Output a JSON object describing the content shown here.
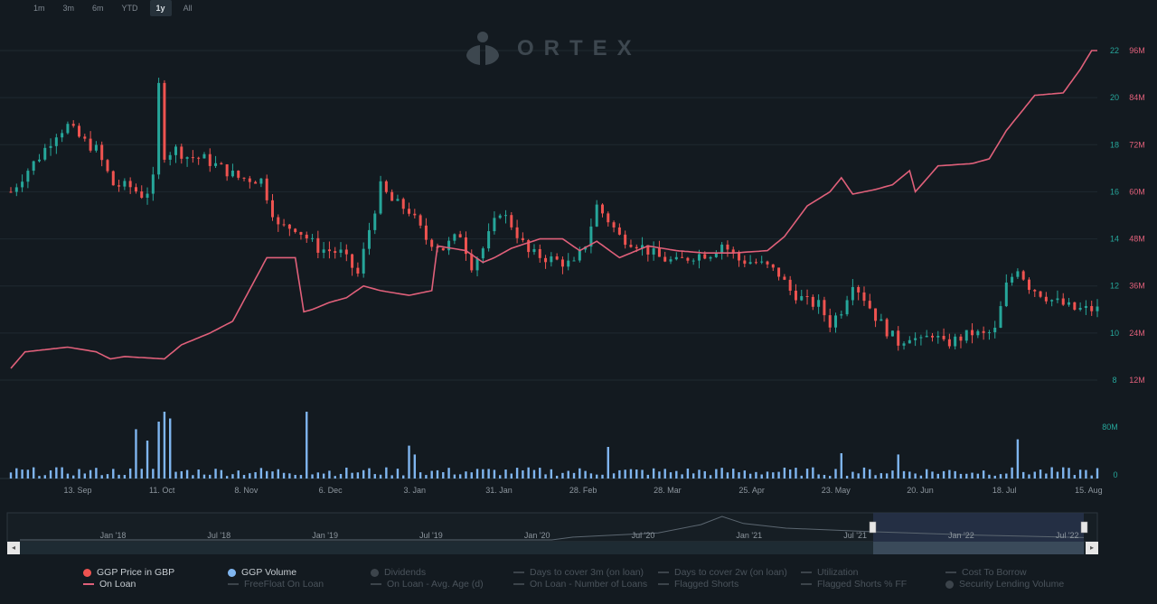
{
  "range_selector": {
    "buttons": [
      "1m",
      "3m",
      "6m",
      "YTD",
      "1y",
      "All"
    ],
    "active": "1y"
  },
  "logo_text": "ORTEX",
  "colors": {
    "up": "#26a69a",
    "down": "#ef5350",
    "on_loan": "#e0607a",
    "volume": "#7fb5ef",
    "left_axis": "#26a69a",
    "right_axis": "#e0607a",
    "background": "#131a20"
  },
  "chart_data": {
    "type": "candlestick",
    "x_tick_labels": [
      "13. Sep",
      "11. Oct",
      "8. Nov",
      "6. Dec",
      "3. Jan",
      "31. Jan",
      "28. Feb",
      "28. Mar",
      "25. Apr",
      "23. May",
      "20. Jun",
      "18. Jul",
      "15. Aug"
    ],
    "price_axis": {
      "ticks": [
        8,
        10,
        12,
        14,
        16,
        18,
        20,
        22
      ],
      "ylim": [
        8,
        22
      ]
    },
    "on_loan_axis": {
      "ticks": [
        "12M",
        "24M",
        "36M",
        "48M",
        "60M",
        "72M",
        "84M",
        "96M"
      ],
      "ylim": [
        12,
        96
      ],
      "unit": "M"
    },
    "volume_axis": {
      "ticks": [
        "0",
        "80M"
      ],
      "ylim": [
        0,
        80
      ]
    },
    "price_series_name": "GGP Price in GBP",
    "volume_series_name": "GGP Volume",
    "on_loan_series_name": "On Loan",
    "price_close_waypoints": [
      [
        0,
        16.0
      ],
      [
        5,
        16.8
      ],
      [
        10,
        17.5
      ],
      [
        16,
        18.5
      ],
      [
        20,
        18.8
      ],
      [
        25,
        18.2
      ],
      [
        30,
        17.8
      ],
      [
        36,
        16.3
      ],
      [
        42,
        16.2
      ],
      [
        47,
        15.8
      ],
      [
        50,
        16.5
      ],
      [
        52,
        20.5
      ],
      [
        54,
        17.6
      ],
      [
        58,
        17.8
      ],
      [
        62,
        17.5
      ],
      [
        68,
        17.4
      ],
      [
        74,
        17.0
      ],
      [
        80,
        16.6
      ],
      [
        88,
        16.5
      ],
      [
        94,
        14.5
      ],
      [
        100,
        14.5
      ],
      [
        108,
        13.6
      ],
      [
        116,
        13.4
      ],
      [
        122,
        12.5
      ],
      [
        126,
        14.4
      ],
      [
        130,
        16.2
      ],
      [
        134,
        15.6
      ],
      [
        140,
        15.2
      ],
      [
        146,
        14.0
      ],
      [
        152,
        13.6
      ],
      [
        158,
        14.2
      ],
      [
        162,
        12.9
      ],
      [
        166,
        13.6
      ],
      [
        172,
        15.2
      ],
      [
        176,
        14.6
      ],
      [
        182,
        13.4
      ],
      [
        188,
        13.2
      ],
      [
        194,
        13.0
      ],
      [
        198,
        12.9
      ],
      [
        202,
        13.8
      ],
      [
        206,
        15.4
      ],
      [
        210,
        14.8
      ],
      [
        214,
        14.1
      ],
      [
        220,
        13.8
      ],
      [
        228,
        13.2
      ],
      [
        234,
        13.0
      ],
      [
        240,
        13.3
      ],
      [
        246,
        13.4
      ],
      [
        250,
        13.8
      ],
      [
        256,
        13.1
      ],
      [
        262,
        13.0
      ],
      [
        266,
        12.8
      ],
      [
        270,
        12.5
      ],
      [
        274,
        11.8
      ],
      [
        280,
        11.3
      ],
      [
        284,
        11.2
      ],
      [
        288,
        10.4
      ],
      [
        292,
        11.0
      ],
      [
        296,
        12.2
      ],
      [
        300,
        11.5
      ],
      [
        304,
        10.7
      ],
      [
        308,
        10.1
      ],
      [
        312,
        9.6
      ],
      [
        316,
        9.9
      ],
      [
        320,
        9.6
      ],
      [
        324,
        10.0
      ],
      [
        328,
        9.5
      ],
      [
        334,
        9.8
      ],
      [
        338,
        10.0
      ],
      [
        342,
        9.9
      ],
      [
        346,
        10.1
      ],
      [
        350,
        12.0
      ],
      [
        354,
        12.8
      ],
      [
        358,
        12.0
      ],
      [
        362,
        11.7
      ],
      [
        366,
        11.4
      ],
      [
        370,
        11.2
      ],
      [
        374,
        11.0
      ]
    ],
    "on_loan_waypoints": [
      [
        0,
        8.5
      ],
      [
        5,
        9.2
      ],
      [
        20,
        9.4
      ],
      [
        30,
        9.2
      ],
      [
        35,
        8.9
      ],
      [
        40,
        9.0
      ],
      [
        54,
        8.9
      ],
      [
        60,
        9.5
      ],
      [
        70,
        10.0
      ],
      [
        78,
        10.5
      ],
      [
        86,
        12.3
      ],
      [
        90,
        13.2
      ],
      [
        100,
        13.2
      ],
      [
        103,
        10.9
      ],
      [
        106,
        11.0
      ],
      [
        112,
        11.3
      ],
      [
        118,
        11.5
      ],
      [
        124,
        12.0
      ],
      [
        130,
        11.8
      ],
      [
        140,
        11.6
      ],
      [
        148,
        11.8
      ],
      [
        150,
        13.7
      ],
      [
        160,
        13.5
      ],
      [
        166,
        13.0
      ],
      [
        170,
        13.2
      ],
      [
        176,
        13.6
      ],
      [
        186,
        14.0
      ],
      [
        194,
        14.0
      ],
      [
        200,
        13.5
      ],
      [
        206,
        13.9
      ],
      [
        214,
        13.2
      ],
      [
        224,
        13.7
      ],
      [
        234,
        13.5
      ],
      [
        244,
        13.4
      ],
      [
        254,
        13.4
      ],
      [
        266,
        13.5
      ],
      [
        272,
        14.1
      ],
      [
        280,
        15.4
      ],
      [
        288,
        16.0
      ],
      [
        292,
        16.6
      ],
      [
        296,
        15.9
      ],
      [
        304,
        16.1
      ],
      [
        310,
        16.3
      ],
      [
        316,
        16.9
      ],
      [
        318,
        16.0
      ],
      [
        326,
        17.1
      ],
      [
        338,
        17.2
      ],
      [
        344,
        17.4
      ],
      [
        350,
        18.6
      ],
      [
        356,
        19.5
      ],
      [
        360,
        20.1
      ],
      [
        370,
        20.2
      ],
      [
        376,
        21.2
      ],
      [
        380,
        22.0
      ],
      [
        382,
        22.0
      ]
    ],
    "volume_spikes": [
      [
        44,
        78
      ],
      [
        48,
        60
      ],
      [
        52,
        90
      ],
      [
        54,
        110
      ],
      [
        56,
        95
      ],
      [
        104,
        140
      ],
      [
        140,
        52
      ],
      [
        142,
        38
      ],
      [
        210,
        50
      ],
      [
        292,
        40
      ],
      [
        312,
        38
      ],
      [
        354,
        62
      ]
    ]
  },
  "navigator": {
    "labels": [
      "Jan '18",
      "Jul '18",
      "Jan '19",
      "Jul '19",
      "Jan '20",
      "Jul '20",
      "Jan '21",
      "Jul '21",
      "Jan '22",
      "Jul '22"
    ],
    "left_arrow": "◂",
    "right_arrow": "▸"
  },
  "legend": {
    "row1": [
      {
        "label": "GGP Price in GBP",
        "marker": "dot",
        "color": "#ef5350",
        "on": true
      },
      {
        "label": "GGP Volume",
        "marker": "dot",
        "color": "#7fb5ef",
        "on": true
      },
      {
        "label": "Dividends",
        "marker": "dot",
        "color": "#3c444b",
        "on": false
      },
      {
        "label": "Days to cover 3m (on loan)",
        "marker": "dash",
        "color": "#3c444b",
        "on": false
      },
      {
        "label": "Days to cover 2w (on loan)",
        "marker": "dash",
        "color": "#3c444b",
        "on": false
      },
      {
        "label": "Utilization",
        "marker": "dash",
        "color": "#3c444b",
        "on": false
      },
      {
        "label": "Cost To Borrow",
        "marker": "dash",
        "color": "#3c444b",
        "on": false
      }
    ],
    "row2": [
      {
        "label": "On Loan",
        "marker": "dash",
        "color": "#e0607a",
        "on": true
      },
      {
        "label": "FreeFloat On Loan",
        "marker": "dash",
        "color": "#3c444b",
        "on": false
      },
      {
        "label": "On Loan - Avg. Age (d)",
        "marker": "dash",
        "color": "#3c444b",
        "on": false
      },
      {
        "label": "On Loan - Number of Loans",
        "marker": "dash",
        "color": "#3c444b",
        "on": false
      },
      {
        "label": "Flagged Shorts",
        "marker": "dash",
        "color": "#3c444b",
        "on": false
      },
      {
        "label": "Flagged Shorts % FF",
        "marker": "dash",
        "color": "#3c444b",
        "on": false
      },
      {
        "label": "Security Lending Volume",
        "marker": "dot",
        "color": "#3c444b",
        "on": false
      }
    ]
  }
}
